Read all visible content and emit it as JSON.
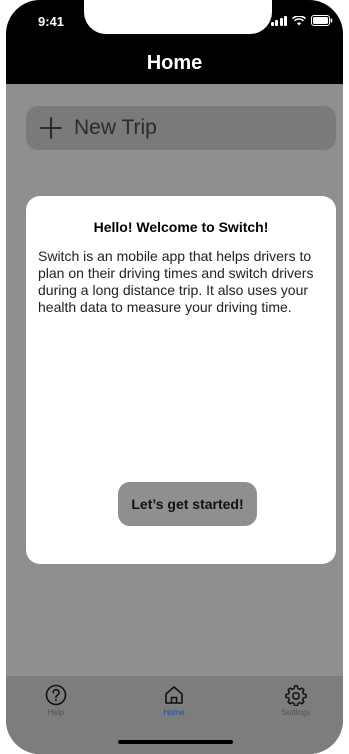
{
  "status_bar": {
    "time": "9:41"
  },
  "header": {
    "title": "Home"
  },
  "new_trip": {
    "label": "New Trip"
  },
  "modal": {
    "title": "Hello! Welcome to Switch!",
    "body": "Switch is an mobile app that helps drivers to plan on their driving times and switch drivers during a long distance trip. It also uses your health data to measure your driving time.",
    "button_label": "Let’s get started!"
  },
  "tabbar": {
    "items": [
      {
        "label": "Help",
        "icon": "help-icon"
      },
      {
        "label": "Home",
        "icon": "home-icon",
        "active": true
      },
      {
        "label": "Settings",
        "icon": "gear-icon"
      }
    ]
  },
  "colors": {
    "active_tab": "#1e4fa0",
    "overlay": "#8f8f8f"
  }
}
